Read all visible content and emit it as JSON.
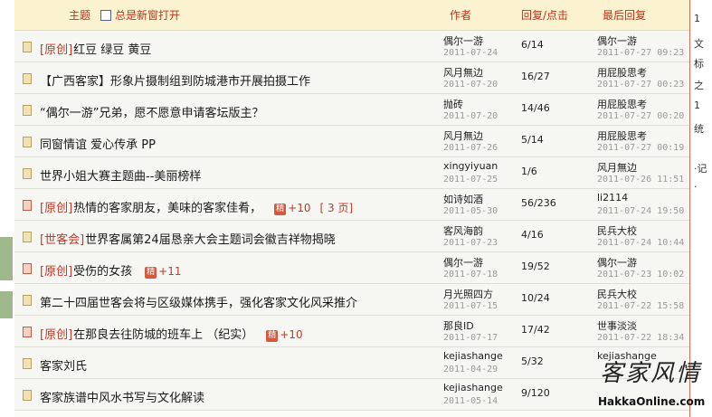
{
  "header": {
    "topic_label": "主题",
    "new_window_label": "总是新窗打开",
    "author_label": "作者",
    "reply_label": "回复/点击",
    "last_label": "最后回复"
  },
  "right_strip": [
    "1",
    "文",
    "标",
    "之",
    "1",
    "统",
    "·记",
    "·"
  ],
  "watermark": {
    "cn": "客家风情",
    "en": "HakkaOnline.com"
  },
  "threads": [
    {
      "icon": "normal",
      "tag": "[原创]",
      "title": "红豆 绿豆 黄豆",
      "jing": false,
      "plus": "",
      "pages": "",
      "author": "偶尔一游",
      "adate": "2011-07-24",
      "reply": "6/14",
      "luser": "偶尔一游",
      "ldate": "2011-07-27 09:23"
    },
    {
      "icon": "normal",
      "tag": "",
      "title": "【广西客家】形象片摄制组到防城港市开展拍摄工作",
      "jing": false,
      "plus": "",
      "pages": "",
      "author": "风月無边",
      "adate": "2011-07-20",
      "reply": "16/27",
      "luser": "用屁股思考",
      "ldate": "2011-07-27 00:23"
    },
    {
      "icon": "normal",
      "tag": "",
      "title": "“偶尔一游”兄弟，愿不愿意申请客坛版主？",
      "jing": false,
      "plus": "",
      "pages": "",
      "author": "抛砖",
      "adate": "2011-07-20",
      "reply": "14/46",
      "luser": "用屁股思考",
      "ldate": "2011-07-27 00:20"
    },
    {
      "icon": "normal",
      "tag": "",
      "title": "同窗情谊 爱心传承 PP",
      "jing": false,
      "plus": "",
      "pages": "",
      "author": "风月無边",
      "adate": "2011-07-26",
      "reply": "5/14",
      "luser": "用屁股思考",
      "ldate": "2011-07-27 00:19"
    },
    {
      "icon": "normal",
      "tag": "",
      "title": "世界小姐大赛主题曲--美丽榜样",
      "jing": false,
      "plus": "",
      "pages": "",
      "author": "xingyiyuan",
      "adate": "2011-07-25",
      "reply": "1/6",
      "luser": "风月無边",
      "ldate": "2011-07-26 11:51"
    },
    {
      "icon": "hot",
      "tag": "[原创]",
      "title": "热情的客家朋友，美味的客家佳肴，",
      "jing": true,
      "plus": "+10",
      "pages": "[ 3 页]",
      "author": "如诗如酒",
      "adate": "2011-05-30",
      "reply": "56/236",
      "luser": "li2114",
      "ldate": "2011-07-24 19:50"
    },
    {
      "icon": "normal",
      "tag": "[世客会]",
      "title": "世界客属第24届恳亲大会主题词会徽吉祥物揭晓",
      "jing": false,
      "plus": "",
      "pages": "",
      "author": "客风海韵",
      "adate": "2011-07-23",
      "reply": "4/16",
      "luser": "民兵大校",
      "ldate": "2011-07-24 10:44"
    },
    {
      "icon": "hot",
      "tag": "[原创]",
      "title": "受伤的女孩",
      "jing": true,
      "plus": "+11",
      "pages": "",
      "author": "偶尔一游",
      "adate": "2011-07-18",
      "reply": "19/52",
      "luser": "偶尔一游",
      "ldate": "2011-07-23 10:02"
    },
    {
      "icon": "normal",
      "tag": "",
      "title": "第二十四届世客会将与区级媒体携手，强化客家文化风采推介",
      "jing": false,
      "plus": "",
      "pages": "",
      "author": "月光照四方",
      "adate": "2011-07-15",
      "reply": "10/24",
      "luser": "民兵大校",
      "ldate": "2011-07-22 15:58"
    },
    {
      "icon": "hot",
      "tag": "[原创]",
      "title": "在那良去往防城的班车上 （纪实）",
      "jing": true,
      "plus": "+10",
      "pages": "",
      "author": "那良ID",
      "adate": "2011-07-17",
      "reply": "17/42",
      "luser": "世事淡淡",
      "ldate": "2011-07-22 18:34"
    },
    {
      "icon": "normal",
      "tag": "",
      "title": "客家刘氏",
      "jing": false,
      "plus": "",
      "pages": "",
      "author": "kejiashange",
      "adate": "2011-04-29",
      "reply": "5/32",
      "luser": "kejiashange",
      "ldate": ""
    },
    {
      "icon": "normal",
      "tag": "",
      "title": "客家族谱中风水书写与文化解读",
      "jing": false,
      "plus": "",
      "pages": "",
      "author": "kejiashange",
      "adate": "2011-05-14",
      "reply": "9/120",
      "luser": "",
      "ldate": ""
    }
  ]
}
